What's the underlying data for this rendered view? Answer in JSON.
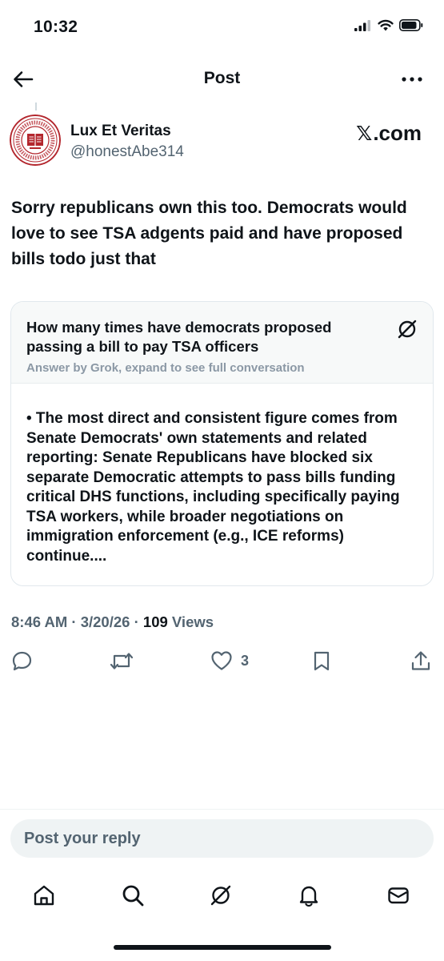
{
  "status": {
    "time": "10:32"
  },
  "nav": {
    "title": "Post",
    "back_icon": "arrow-left-icon",
    "more_icon": "more-horizontal-icon"
  },
  "author": {
    "name": "Lux Et Veritas",
    "handle": "@honestAbe314",
    "source_logo": "𝕏",
    "source_text": ".com"
  },
  "post": {
    "text": "Sorry republicans own this too.  Democrats would love to see TSA adgents paid and have proposed bills todo just that"
  },
  "grok_card": {
    "question": "How many times have democrats proposed passing a bill to pay TSA officers",
    "subtitle": "Answer by Grok, expand to see full conversation",
    "answer": "• The most direct and consistent figure comes from Senate Democrats' own statements and related reporting: Senate Republicans have blocked six separate Democratic attempts to pass bills funding critical DHS functions, including specifically paying TSA workers, while broader negotiations on immigration enforcement (e.g., ICE reforms) continue....",
    "icon": "grok-icon"
  },
  "meta": {
    "time": "8:46 AM",
    "sep1": " · ",
    "date": "3/20/26",
    "sep2": " · ",
    "views_count": "109",
    "views_label": " Views"
  },
  "actions": {
    "reply_icon": "reply-icon",
    "repost_icon": "repost-icon",
    "like_icon": "heart-icon",
    "like_count": "3",
    "bookmark_icon": "bookmark-icon",
    "share_icon": "share-icon"
  },
  "reply": {
    "placeholder": "Post your reply"
  },
  "tabs": [
    {
      "name": "home",
      "icon": "home-icon"
    },
    {
      "name": "search",
      "icon": "search-icon"
    },
    {
      "name": "grok",
      "icon": "grok-icon"
    },
    {
      "name": "notifications",
      "icon": "bell-icon"
    },
    {
      "name": "messages",
      "icon": "mail-icon"
    }
  ],
  "colors": {
    "text": "#0f1419",
    "secondary": "#536471",
    "card_border": "#e1e8ed",
    "card_head_bg": "#f7f9f9",
    "avatar_red": "#b3262d"
  }
}
